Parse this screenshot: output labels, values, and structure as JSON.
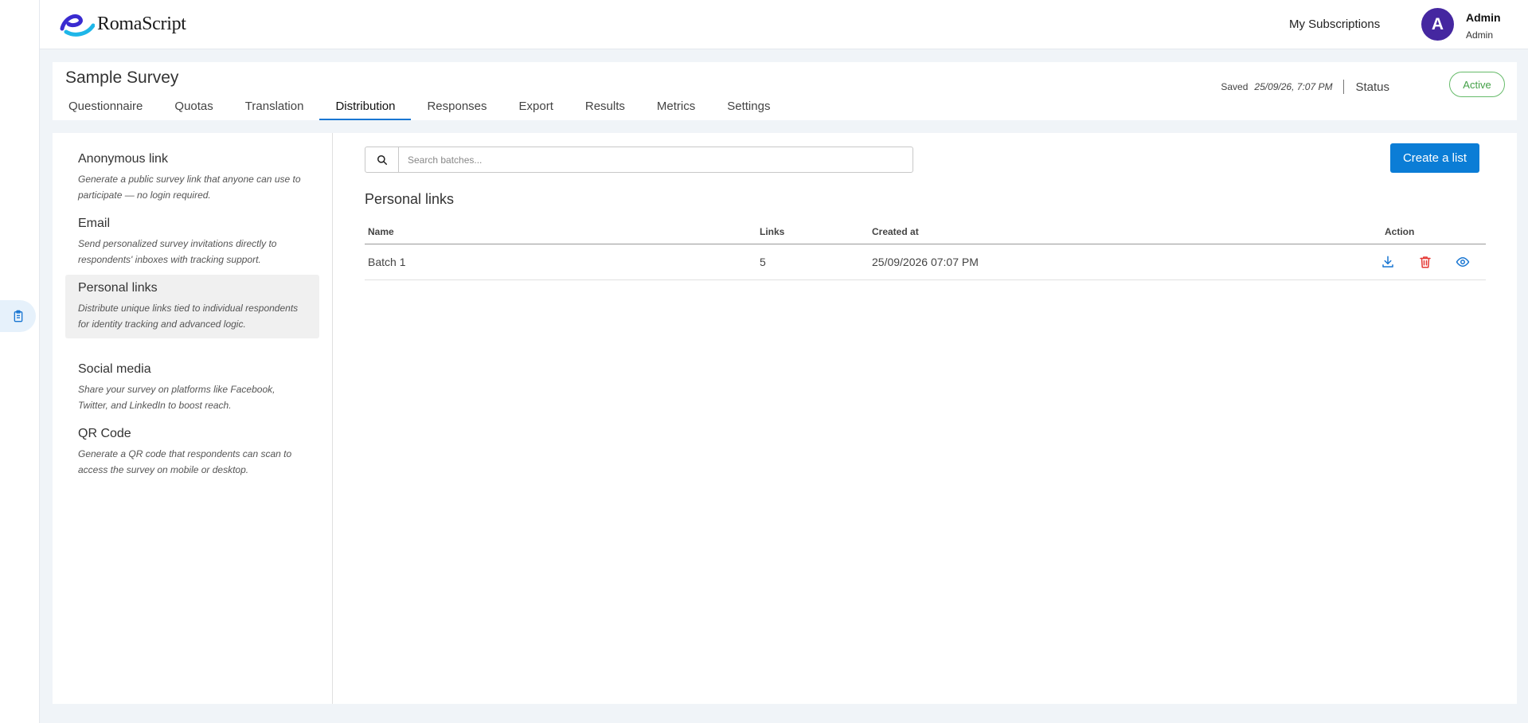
{
  "app": {
    "logo_text": "RomaScript"
  },
  "header": {
    "subscriptions_label": "My Subscriptions",
    "avatar_letter": "A",
    "user_name": "Admin",
    "user_role": "Admin"
  },
  "survey": {
    "title": "Sample Survey",
    "saved_label": "Saved",
    "saved_time": "25/09/26, 7:07 PM",
    "status_label": "Status",
    "status_value": "Active"
  },
  "tabs": [
    {
      "label": "Questionnaire"
    },
    {
      "label": "Quotas"
    },
    {
      "label": "Translation"
    },
    {
      "label": "Distribution",
      "active": true
    },
    {
      "label": "Responses"
    },
    {
      "label": "Export"
    },
    {
      "label": "Results"
    },
    {
      "label": "Metrics"
    },
    {
      "label": "Settings"
    }
  ],
  "distribution_methods": [
    {
      "title": "Anonymous link",
      "description": "Generate a public survey link that anyone can use to participate — no login required."
    },
    {
      "title": "Email",
      "description": "Send personalized survey invitations directly to respondents' inboxes with tracking support."
    },
    {
      "title": "Personal links",
      "description": "Distribute unique links tied to individual respondents for identity tracking and advanced logic.",
      "active": true
    },
    {
      "title": "Social media",
      "description": "Share your survey on platforms like Facebook, Twitter, and LinkedIn to boost reach."
    },
    {
      "title": "QR Code",
      "description": "Generate a QR code that respondents can scan to access the survey on mobile or desktop."
    }
  ],
  "personal_links": {
    "search_placeholder": "Search batches...",
    "create_button": "Create a list",
    "section_title": "Personal links",
    "columns": {
      "name": "Name",
      "links": "Links",
      "created_at": "Created at",
      "action": "Action"
    },
    "rows": [
      {
        "name": "Batch 1",
        "links": "5",
        "created_at": "25/09/2026 07:07 PM"
      }
    ]
  },
  "icons": {
    "rail": "clipboard-icon",
    "search": "search-icon",
    "row_actions": [
      "download-icon",
      "trash-icon",
      "eye-icon"
    ]
  },
  "colors": {
    "accent": "#0b7dd6",
    "avatar": "#4527a0",
    "status_active": "#43a047",
    "delete": "#e53935"
  }
}
